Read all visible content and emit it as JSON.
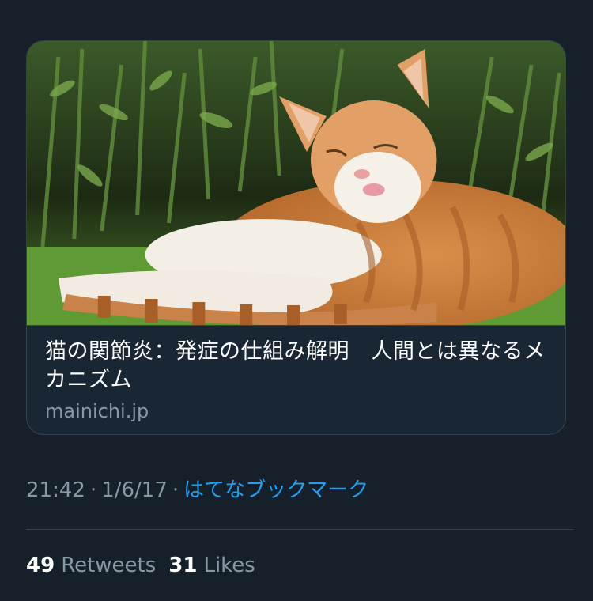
{
  "card": {
    "title": "猫の関節炎：発症の仕組み解明　人間とは異なるメカニズム",
    "domain": "mainichi.jp"
  },
  "meta": {
    "time": "21:42",
    "separator": "·",
    "date": "1/6/17",
    "source": "はてなブックマーク"
  },
  "stats": {
    "retweets_count": "49",
    "retweets_label": "Retweets",
    "likes_count": "31",
    "likes_label": "Likes"
  },
  "colors": {
    "background": "#15202b",
    "border": "#38444d",
    "secondary_text": "#8899a6",
    "link": "#1da1f2"
  }
}
